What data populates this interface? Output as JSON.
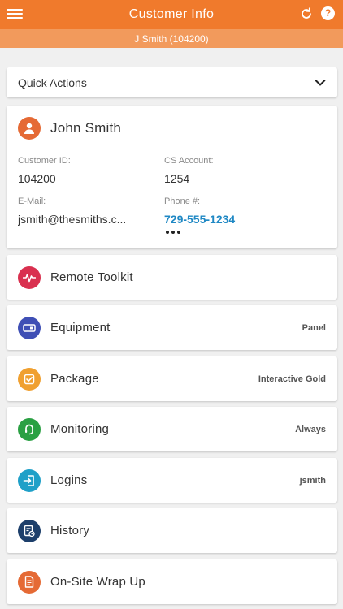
{
  "header": {
    "title": "Customer Info",
    "subtitle": "J Smith (104200)"
  },
  "quick_actions": {
    "label": "Quick Actions"
  },
  "customer": {
    "name": "John Smith",
    "fields": {
      "customer_id_label": "Customer ID:",
      "customer_id": "104200",
      "cs_account_label": "CS Account:",
      "cs_account": "1254",
      "email_label": "E-Mail:",
      "email": "jsmith@thesmiths.c...",
      "phone_label": "Phone #:",
      "phone": "729-555-1234"
    }
  },
  "menu": [
    {
      "label": "Remote Toolkit",
      "detail": "",
      "icon": "pulse-icon",
      "color": "#d9304f"
    },
    {
      "label": "Equipment",
      "detail": "Panel",
      "icon": "panel-icon",
      "color": "#3f4fb5"
    },
    {
      "label": "Package",
      "detail": "Interactive Gold",
      "icon": "checkbox-icon",
      "color": "#f0a030"
    },
    {
      "label": "Monitoring",
      "detail": "Always",
      "icon": "headset-icon",
      "color": "#2aa043"
    },
    {
      "label": "Logins",
      "detail": "jsmith",
      "icon": "login-icon",
      "color": "#1fa0c8"
    },
    {
      "label": "History",
      "detail": "",
      "icon": "history-icon",
      "color": "#1d3f6b"
    },
    {
      "label": "On-Site Wrap Up",
      "detail": "",
      "icon": "document-icon",
      "color": "#e56a35"
    }
  ],
  "colors": {
    "primary": "#f07a2c",
    "subheader": "#f29a5c",
    "link": "#1f88c4"
  }
}
